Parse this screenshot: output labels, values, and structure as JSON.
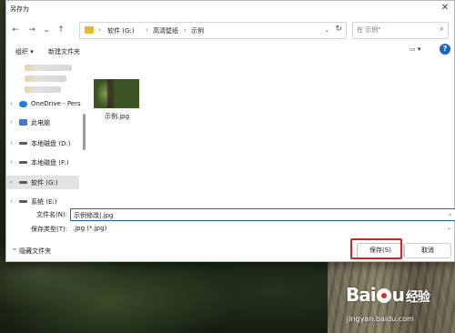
{
  "dialog": {
    "title": "另存为",
    "close_glyph": "✕"
  },
  "address_bar": {
    "crumbs": [
      "软件 (G:)",
      "高清壁纸",
      "示例"
    ],
    "separator": "›",
    "dropdown_glyph": "⌄",
    "refresh_glyph": "↻"
  },
  "nav_buttons": {
    "back": "←",
    "forward": "→",
    "recent": "⌄",
    "up": "↑"
  },
  "search": {
    "placeholder": "在 示例 中搜索",
    "value": "在 示例\"",
    "icon": "search-icon"
  },
  "toolbar": {
    "organize": "组织 ▾",
    "new_folder": "新建文件夹",
    "view": "▭ ▾",
    "help": "?"
  },
  "nav_pane": {
    "items": [
      {
        "label": "OneDrive - Pers",
        "icon": "cloud-icon"
      },
      {
        "label": "此电脑",
        "icon": "computer-icon"
      },
      {
        "label": "本地磁盘 (D:)",
        "icon": "drive-icon"
      },
      {
        "label": "本地磁盘 (F:)",
        "icon": "drive-icon"
      },
      {
        "label": "软件 (G:)",
        "icon": "drive-icon",
        "selected": true
      },
      {
        "label": "系统 (E:)",
        "icon": "drive-icon"
      }
    ],
    "chevron": "›"
  },
  "files": [
    {
      "name": "示例.jpg"
    }
  ],
  "form": {
    "filename_label": "文件名(N):",
    "filename_value": "示例修改|.jpg",
    "filetype_label": "保存类型(T):",
    "filetype_value": ".jpg (*.jpg)",
    "dropdown_glyph": "⌄"
  },
  "footer": {
    "hide_folders": "⌃  隐藏文件夹",
    "save": "保存(S)",
    "cancel": "取消"
  },
  "watermark": {
    "brand_left": "Bai",
    "brand_right": "u",
    "brand_suffix": "经验",
    "url": "jingyan.baidu.com"
  },
  "colors": {
    "accent": "#1e64c8",
    "highlight_box": "#e02020",
    "folder": "#e8b730"
  }
}
